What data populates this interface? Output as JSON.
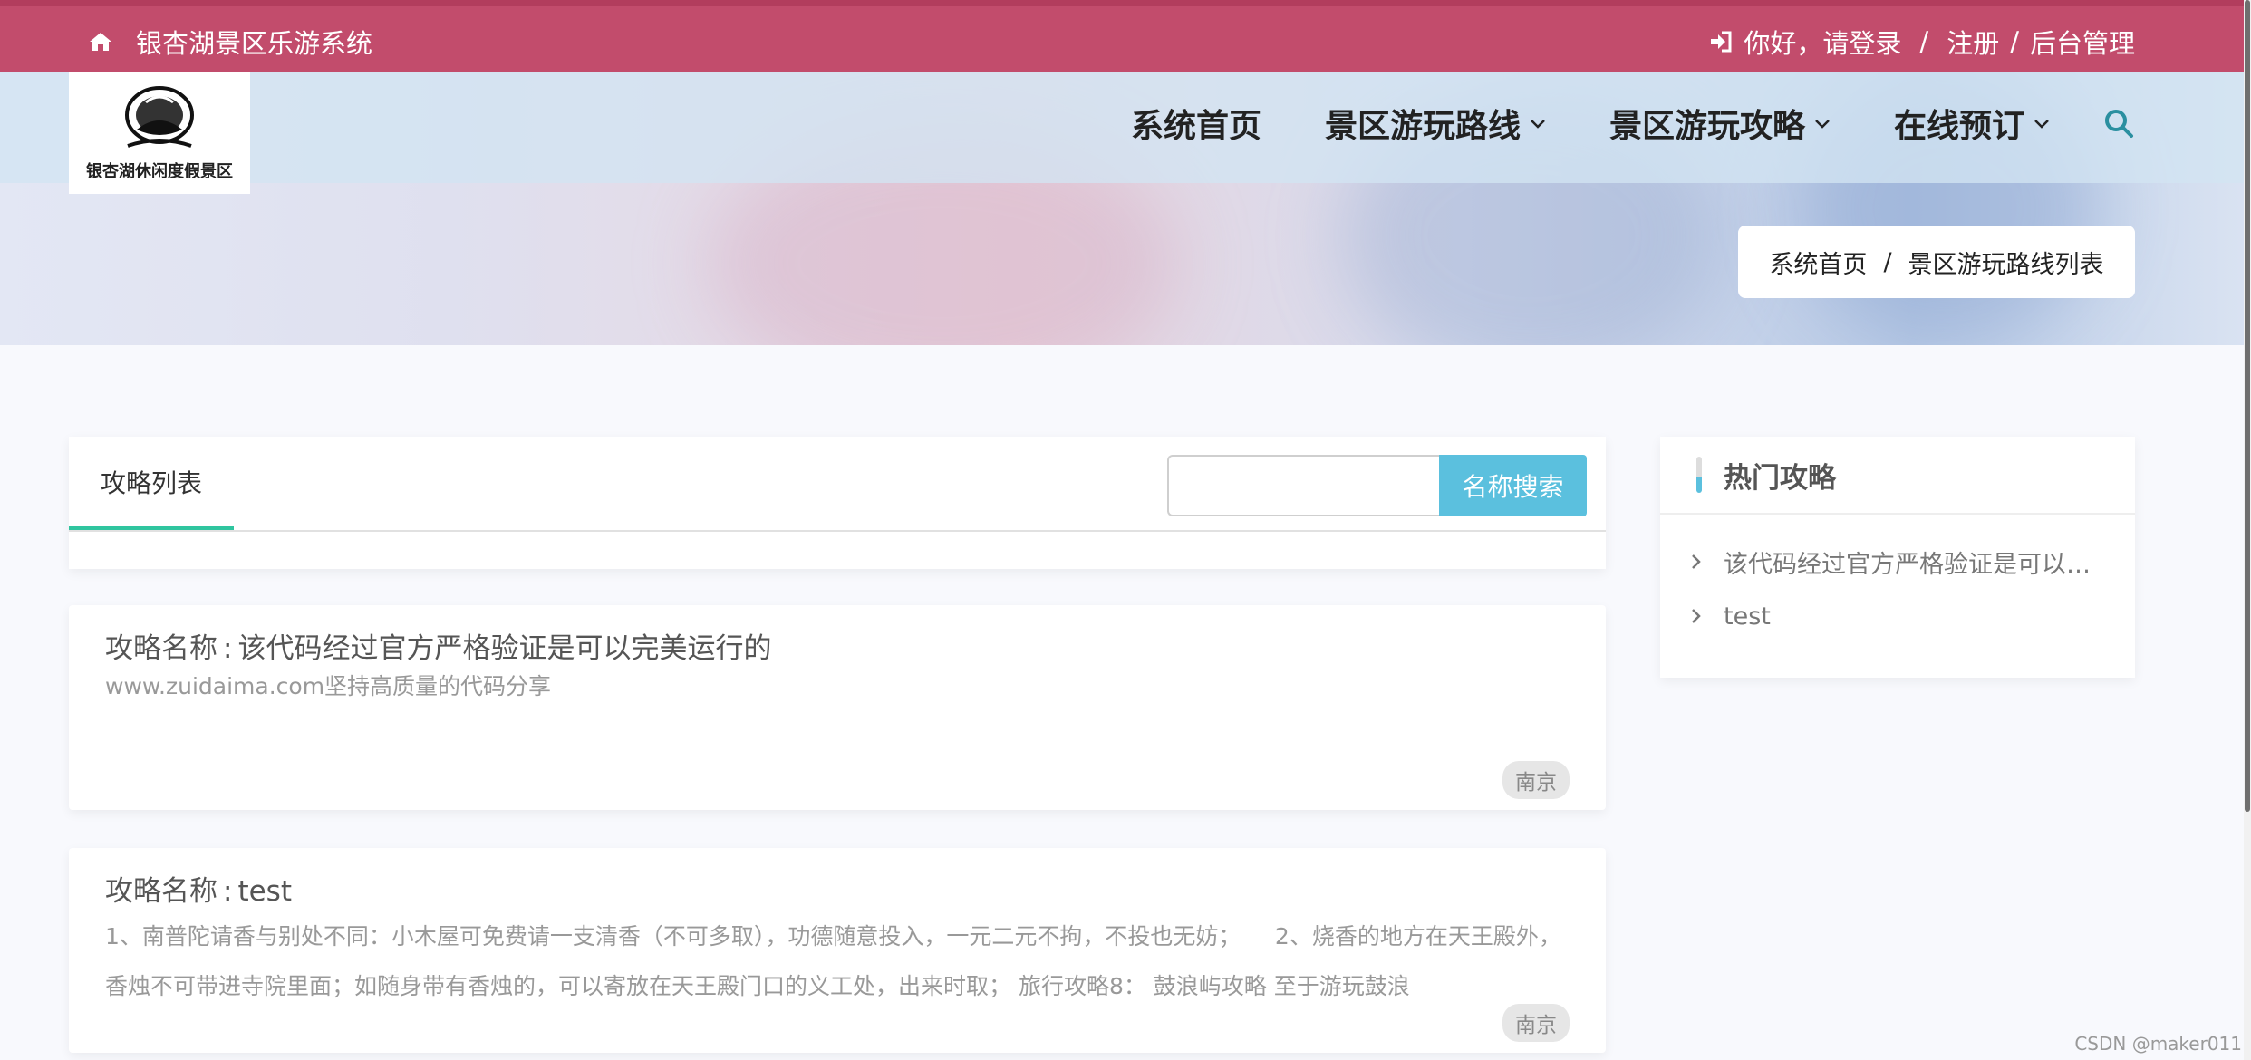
{
  "topbar": {
    "home_icon": "home-icon",
    "site_title": "银杏湖景区乐游系统",
    "login_icon": "sign-in-icon",
    "login_text": "你好，请登录",
    "sep1": "/",
    "register_text": "注册",
    "sep2": "/",
    "admin_text": "后台管理"
  },
  "logo": {
    "caption": "银杏湖休闲度假景区"
  },
  "nav": {
    "items": [
      {
        "label": "系统首页",
        "dropdown": false
      },
      {
        "label": "景区游玩路线",
        "dropdown": true
      },
      {
        "label": "景区游玩攻略",
        "dropdown": true
      },
      {
        "label": "在线预订",
        "dropdown": true
      }
    ],
    "search_icon": "search-icon"
  },
  "breadcrumb": {
    "home": "系统首页",
    "sep": "/",
    "current": "景区游玩路线列表"
  },
  "list": {
    "tab_label": "攻略列表",
    "search_placeholder": "",
    "search_button": "名称搜索",
    "title_prefix": "攻略名称",
    "title_colon": ":",
    "articles": [
      {
        "title": "该代码经过官方严格验证是可以完美运行的",
        "desc": "www.zuidaima.com坚持高质量的代码分享",
        "tag": "南京"
      },
      {
        "title": "test",
        "desc": "1、南普陀请香与别处不同：小木屋可免费请一支清香（不可多取），功德随意投入，一元二元不拘，不投也无妨；　　2、烧香的地方在天王殿外，香烛不可带进寺院里面；如随身带有香烛的，可以寄放在天王殿门口的义工处，出来时取；  旅行攻略8：  鼓浪屿攻略 至于游玩鼓浪",
        "tag": "南京"
      }
    ]
  },
  "sidebar": {
    "title": "热门攻略",
    "items": [
      {
        "label": "该代码经过官方严格验证是可以完美运行的"
      },
      {
        "label": "test"
      }
    ]
  },
  "watermark": "CSDN @maker011"
}
